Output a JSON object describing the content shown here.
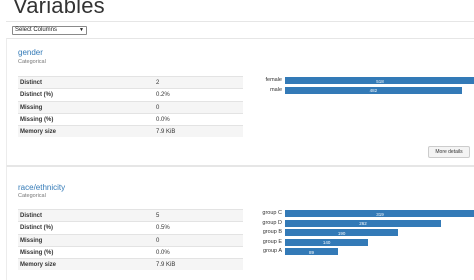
{
  "page": {
    "title": "Variables"
  },
  "columns_select": {
    "value": "Select Columns",
    "caret": "▼"
  },
  "variables": [
    {
      "name": "gender",
      "type": "Categorical",
      "stats": [
        {
          "label": "Distinct",
          "value": "2"
        },
        {
          "label": "Distinct (%)",
          "value": "0.2%"
        },
        {
          "label": "Missing",
          "value": "0"
        },
        {
          "label": "Missing (%)",
          "value": "0.0%"
        },
        {
          "label": "Memory size",
          "value": "7.9 KiB"
        }
      ],
      "bars": [
        {
          "category": "female",
          "count": 518
        },
        {
          "category": "male",
          "count": 482
        }
      ],
      "details_button": "More details",
      "bar_color": "#337ab7"
    },
    {
      "name": "race/ethnicity",
      "type": "Categorical",
      "stats": [
        {
          "label": "Distinct",
          "value": "5"
        },
        {
          "label": "Distinct (%)",
          "value": "0.5%"
        },
        {
          "label": "Missing",
          "value": "0"
        },
        {
          "label": "Missing (%)",
          "value": "0.0%"
        },
        {
          "label": "Memory size",
          "value": "7.9 KiB"
        }
      ],
      "bars": [
        {
          "category": "group C",
          "count": 319
        },
        {
          "category": "group D",
          "count": 262
        },
        {
          "category": "group B",
          "count": 190
        },
        {
          "category": "group E",
          "count": 140
        },
        {
          "category": "group A",
          "count": 89
        }
      ],
      "bar_color": "#337ab7"
    }
  ]
}
